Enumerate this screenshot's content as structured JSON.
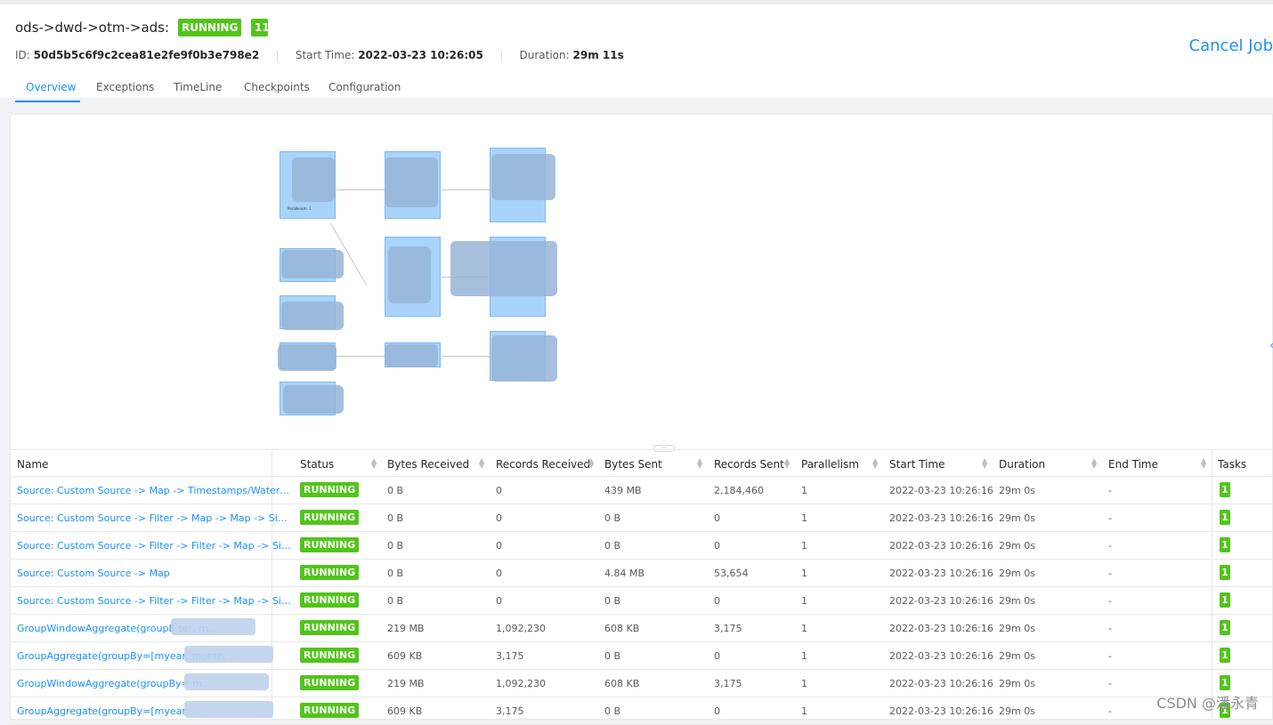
{
  "job": {
    "title": "ods->dwd->otm->ads:",
    "status": "RUNNING",
    "task_count": "11",
    "id_label": "ID:",
    "id": "50d5b5c6f9c2cea81e2fe9f0b3e798e2",
    "start_label": "Start Time:",
    "start": "2022-03-23 10:26:05",
    "duration_label": "Duration:",
    "duration": "29m 11s",
    "cancel_label": "Cancel Job"
  },
  "tabs": [
    {
      "label": "Overview",
      "active": true
    },
    {
      "label": "Exceptions",
      "active": false
    },
    {
      "label": "TimeLine",
      "active": false
    },
    {
      "label": "Checkpoints",
      "active": false
    },
    {
      "label": "Configuration",
      "active": false
    }
  ],
  "graph": {
    "node_label": "Parallelism: 1",
    "resize_handle": "...",
    "edge_marker": "‹"
  },
  "table": {
    "headers": [
      "Name",
      "Status",
      "Bytes Received",
      "Records Received",
      "Bytes Sent",
      "Records Sent",
      "Parallelism",
      "Start Time",
      "Duration",
      "End Time",
      "Tasks"
    ],
    "rows": [
      {
        "name": "Source: Custom Source -> Map -> Timestamps/Watermar...",
        "status": "RUNNING",
        "bytes_received": "0 B",
        "records_received": "0",
        "bytes_sent": "439 MB",
        "records_sent": "2,184,460",
        "parallelism": "1",
        "start": "2022-03-23 10:26:16",
        "duration": "29m 0s",
        "end": "-",
        "tasks": "1"
      },
      {
        "name": "Source: Custom Source -> Filter -> Map -> Map -> Sink: ...",
        "status": "RUNNING",
        "bytes_received": "0 B",
        "records_received": "0",
        "bytes_sent": "0 B",
        "records_sent": "0",
        "parallelism": "1",
        "start": "2022-03-23 10:26:16",
        "duration": "29m 0s",
        "end": "-",
        "tasks": "1"
      },
      {
        "name": "Source: Custom Source -> Filter -> Filter -> Map -> Sink: ...",
        "status": "RUNNING",
        "bytes_received": "0 B",
        "records_received": "0",
        "bytes_sent": "0 B",
        "records_sent": "0",
        "parallelism": "1",
        "start": "2022-03-23 10:26:16",
        "duration": "29m 0s",
        "end": "-",
        "tasks": "1"
      },
      {
        "name": "Source: Custom Source -> Map",
        "status": "RUNNING",
        "bytes_received": "0 B",
        "records_received": "0",
        "bytes_sent": "4.84 MB",
        "records_sent": "53,654",
        "parallelism": "1",
        "start": "2022-03-23 10:26:16",
        "duration": "29m 0s",
        "end": "-",
        "tasks": "1"
      },
      {
        "name": "Source: Custom Source -> Filter -> Filter -> Map -> Sink: ...",
        "status": "RUNNING",
        "bytes_received": "0 B",
        "records_received": "0",
        "bytes_sent": "0 B",
        "records_sent": "0",
        "parallelism": "1",
        "start": "2022-03-23 10:26:16",
        "duration": "29m 0s",
        "end": "-",
        "tasks": "1"
      },
      {
        "name": "GroupWindowAggregate(groupB                              ter, m...",
        "status": "RUNNING",
        "bytes_received": "219 MB",
        "records_received": "1,092,230",
        "bytes_sent": "608 KB",
        "records_sent": "3,175",
        "parallelism": "1",
        "start": "2022-03-23 10:26:16",
        "duration": "29m 0s",
        "end": "-",
        "tasks": "1"
      },
      {
        "name": "GroupAggregate(groupBy=[myear,                    month, ...",
        "status": "RUNNING",
        "bytes_received": "609 KB",
        "records_received": "3,175",
        "bytes_sent": "0 B",
        "records_sent": "0",
        "parallelism": "1",
        "start": "2022-03-23 10:26:16",
        "duration": "29m 0s",
        "end": "-",
        "tasks": "1"
      },
      {
        "name": "GroupWindowAggregate(groupBy=                             m...",
        "status": "RUNNING",
        "bytes_received": "219 MB",
        "records_received": "1,092,230",
        "bytes_sent": "608 KB",
        "records_sent": "3,175",
        "parallelism": "1",
        "start": "2022-03-23 10:26:16",
        "duration": "29m 0s",
        "end": "-",
        "tasks": "1"
      },
      {
        "name": "GroupAggregate(groupBy=[myear,                             ...",
        "status": "RUNNING",
        "bytes_received": "609 KB",
        "records_received": "3,175",
        "bytes_sent": "0 B",
        "records_sent": "0",
        "parallelism": "1",
        "start": "2022-03-23 10:26:16",
        "duration": "29m 0s",
        "end": "-",
        "tasks": "1"
      }
    ]
  },
  "watermark": "CSDN @潘永青",
  "colors": {
    "primary": "#1890ff",
    "success": "#52c41a",
    "node_fill": "#a8d4fb"
  }
}
